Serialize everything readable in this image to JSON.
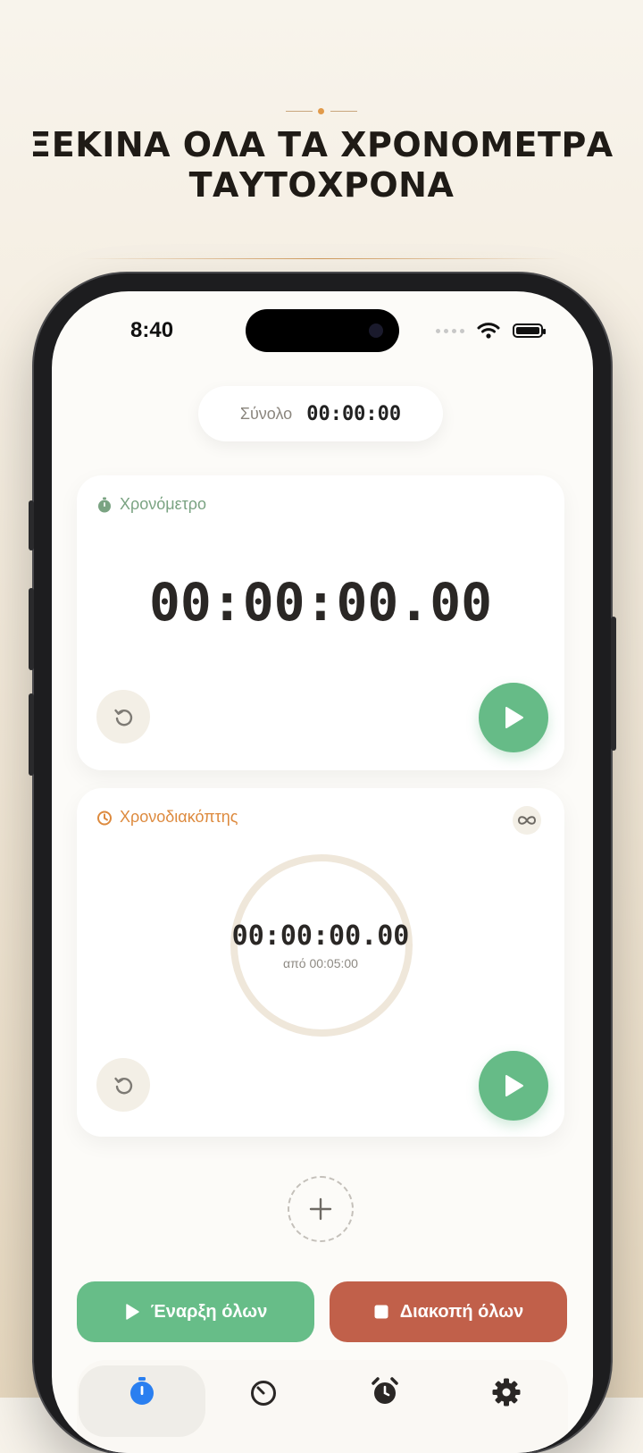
{
  "headline": {
    "line1": "ΞΕΚΙΝΑ ΟΛΑ ΤΑ ΧΡΟΝΟΜΕΤΡΑ",
    "line2": "ΤΑΥΤΟΧΡΟΝΑ"
  },
  "status_bar": {
    "time": "8:40"
  },
  "total": {
    "label": "Σύνολο",
    "value": "00:00:00"
  },
  "stopwatch": {
    "title": "Χρονόμετρο",
    "time": "00:00:00.00",
    "accent": "#7aa382"
  },
  "timer": {
    "title": "Χρονοδιακόπτης",
    "time": "00:00:00.00",
    "subtitle": "από 00:05:00",
    "accent": "#dd8a3e",
    "progress": 0
  },
  "actions": {
    "start_all": "Έναρξη όλων",
    "stop_all": "Διακοπή όλων"
  },
  "tabs": [
    {
      "icon": "stopwatch-icon",
      "active": true
    },
    {
      "icon": "timer-icon",
      "active": false
    },
    {
      "icon": "alarm-icon",
      "active": false
    },
    {
      "icon": "gear-icon",
      "active": false
    }
  ],
  "colors": {
    "play": "#66bb87",
    "stop": "#c1604a",
    "active_tab": "#2a7ff0"
  }
}
